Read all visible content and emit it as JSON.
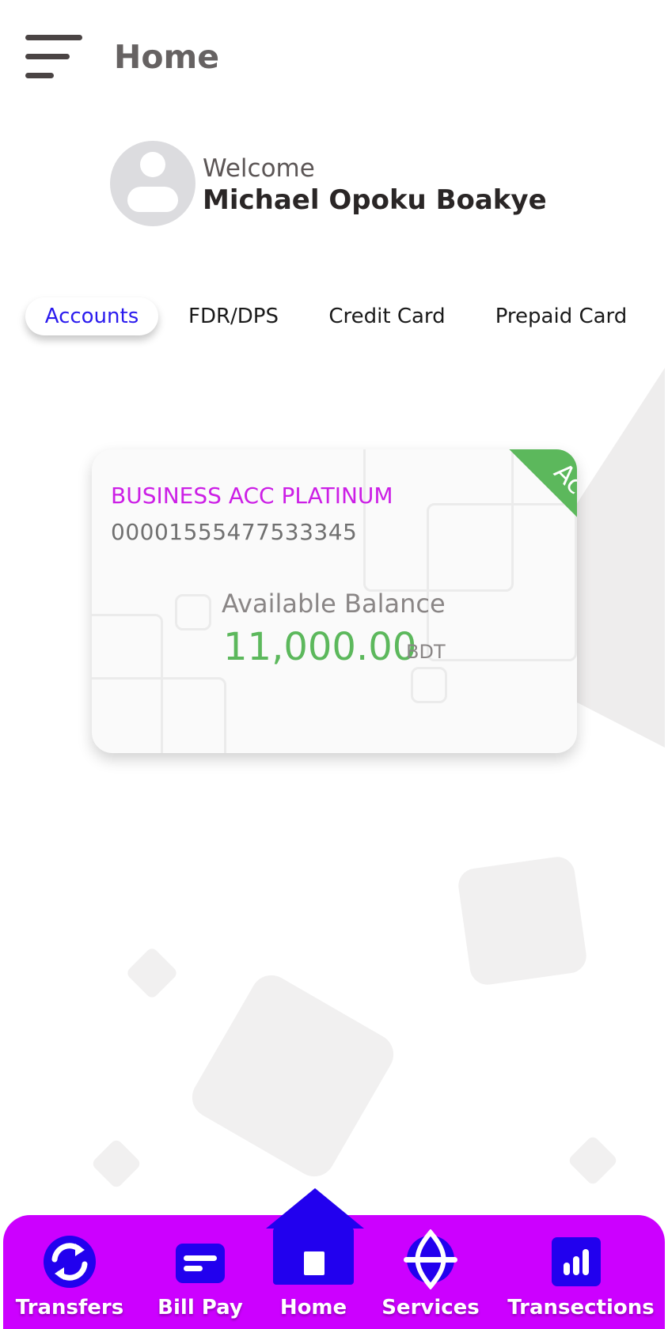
{
  "header": {
    "title": "Home",
    "menu_icon": "hamburger-menu-icon"
  },
  "welcome": {
    "greeting": "Welcome",
    "user_name": "Michael Opoku Boakye",
    "avatar_icon": "user-avatar-icon"
  },
  "tabs": [
    {
      "label": "Accounts",
      "active": true
    },
    {
      "label": "FDR/DPS",
      "active": false
    },
    {
      "label": "Credit Card",
      "active": false
    },
    {
      "label": "Prepaid Card",
      "active": false
    }
  ],
  "account_card": {
    "name": "BUSINESS ACC PLATINUM",
    "number": "00001555477533345",
    "status": "Active",
    "balance_label": "Available Balance",
    "balance": "11,000.00",
    "currency": "BDT"
  },
  "bottom_nav": [
    {
      "label": "Transfers",
      "icon": "transfer-arrows-icon"
    },
    {
      "label": "Bill Pay",
      "icon": "bill-card-icon"
    },
    {
      "label": "Home",
      "icon": "home-icon",
      "active": true
    },
    {
      "label": "Services",
      "icon": "services-icon"
    },
    {
      "label": "Transections",
      "icon": "bar-chart-icon"
    }
  ],
  "colors": {
    "brand": "#cc00ff",
    "primary": "#2200ee",
    "account_name": "#cc1fe6",
    "balance": "#5cb85c",
    "status_active": "#5cb85c"
  }
}
